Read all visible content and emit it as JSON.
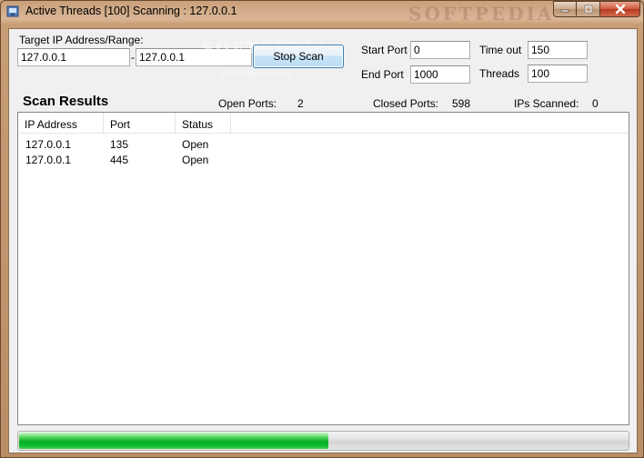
{
  "window": {
    "title": "Active Threads [100] Scanning : 127.0.0.1",
    "title_watermark": "SOFTPEDIA"
  },
  "form": {
    "target_label": "Target IP Address/Range:",
    "range_start": "127.0.0.1",
    "range_separator": "-",
    "range_end": "127.0.0.1",
    "scan_button": "Stop Scan",
    "start_port_label": "Start Port",
    "start_port": "0",
    "end_port_label": "End Port",
    "end_port": "1000",
    "timeout_label": "Time out",
    "timeout": "150",
    "threads_label": "Threads",
    "threads": "100",
    "watermark_text": "SOFTPEDIA",
    "watermark_url": "www.softpedia.com"
  },
  "results": {
    "title": "Scan Results",
    "open_ports_label": "Open Ports:",
    "open_ports": "2",
    "closed_ports_label": "Closed Ports:",
    "closed_ports": "598",
    "ips_scanned_label": "IPs Scanned:",
    "ips_scanned": "0",
    "columns": [
      "IP Address",
      "Port",
      "Status"
    ],
    "rows": [
      {
        "ip": "127.0.0.1",
        "port": "135",
        "status": "Open"
      },
      {
        "ip": "127.0.0.1",
        "port": "445",
        "status": "Open"
      }
    ]
  },
  "progress": {
    "fraction": 0.51,
    "color": "#06b025"
  },
  "icons": {
    "app": "app-icon",
    "minimize": "minimize-icon",
    "maximize": "maximize-icon",
    "close": "close-icon"
  }
}
